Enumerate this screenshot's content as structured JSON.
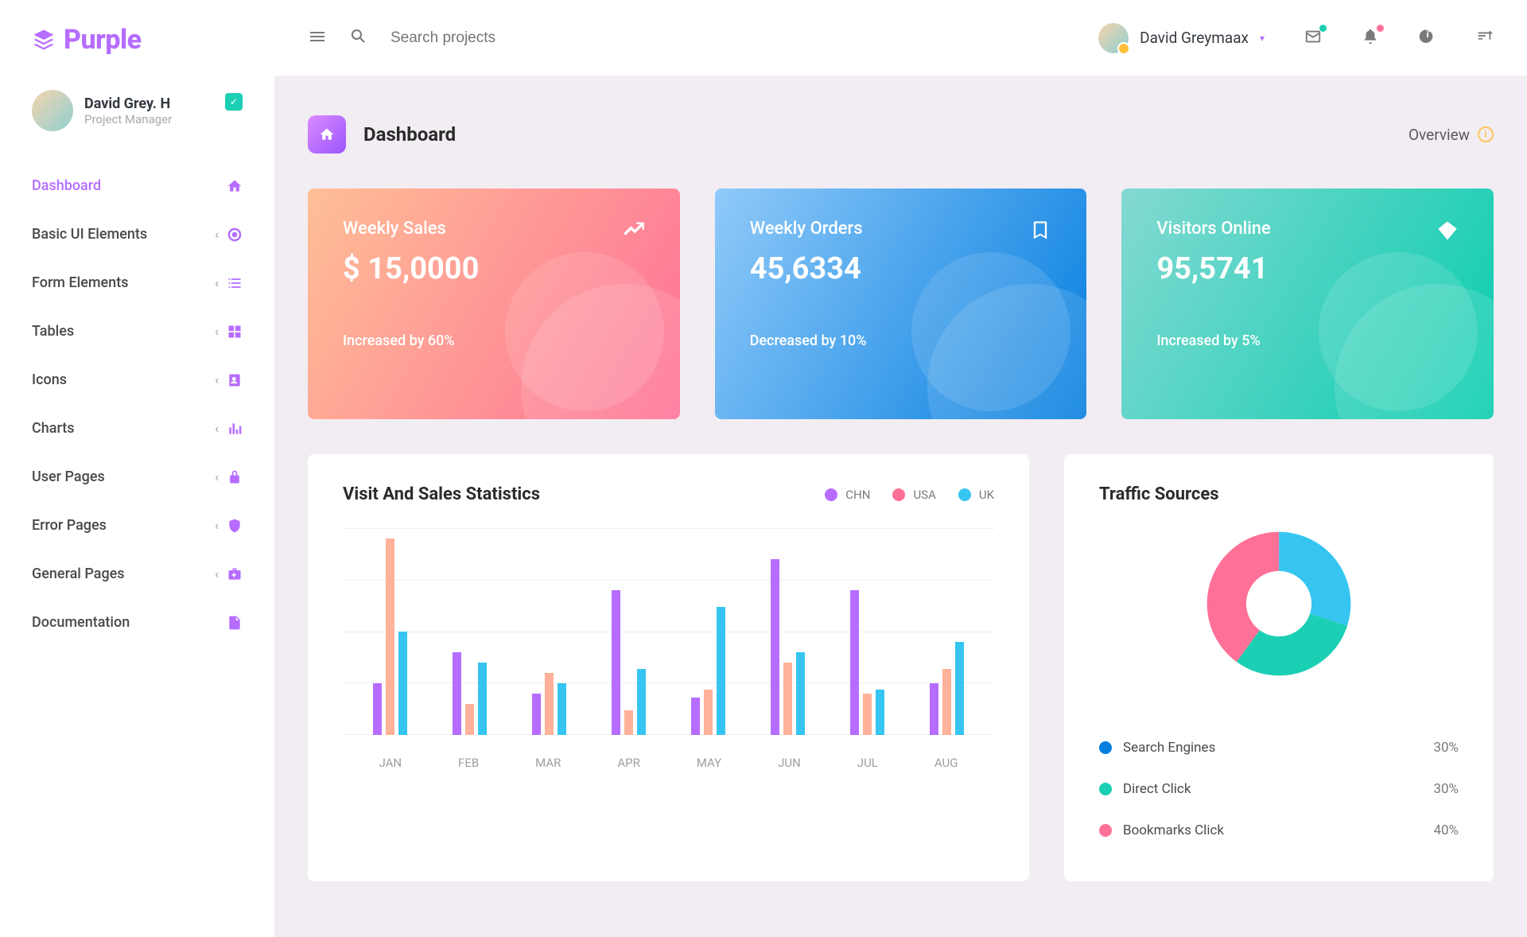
{
  "brand": "Purple",
  "topbar": {
    "search_placeholder": "Search projects",
    "user_name": "David Greymaax"
  },
  "profile": {
    "name": "David Grey. H",
    "role": "Project Manager"
  },
  "nav": [
    {
      "label": "Dashboard",
      "icon": "home",
      "active": true,
      "expandable": false
    },
    {
      "label": "Basic UI Elements",
      "icon": "target",
      "expandable": true
    },
    {
      "label": "Form Elements",
      "icon": "list",
      "expandable": true
    },
    {
      "label": "Tables",
      "icon": "grid",
      "expandable": true
    },
    {
      "label": "Icons",
      "icon": "contacts",
      "expandable": true
    },
    {
      "label": "Charts",
      "icon": "chart",
      "expandable": true
    },
    {
      "label": "User Pages",
      "icon": "lock",
      "expandable": true
    },
    {
      "label": "Error Pages",
      "icon": "shield",
      "expandable": true
    },
    {
      "label": "General Pages",
      "icon": "medkit",
      "expandable": true
    },
    {
      "label": "Documentation",
      "icon": "doc",
      "expandable": false
    }
  ],
  "page": {
    "title": "Dashboard",
    "overview_label": "Overview"
  },
  "stats": [
    {
      "title": "Weekly Sales",
      "value": "$ 15,0000",
      "sub": "Increased by 60%",
      "variant": "red",
      "icon": "chart-line"
    },
    {
      "title": "Weekly Orders",
      "value": "45,6334",
      "sub": "Decreased by 10%",
      "variant": "blue",
      "icon": "bookmark"
    },
    {
      "title": "Visitors Online",
      "value": "95,5741",
      "sub": "Increased by 5%",
      "variant": "green",
      "icon": "diamond"
    }
  ],
  "bar_chart": {
    "title": "Visit And Sales Statistics",
    "legend": [
      {
        "label": "CHN",
        "color": "#b66dff"
      },
      {
        "label": "USA",
        "color": "#fe7096"
      },
      {
        "label": "UK",
        "color": "#36c5f0"
      }
    ]
  },
  "traffic": {
    "title": "Traffic Sources",
    "items": [
      {
        "label": "Search Engines",
        "pct": "30%",
        "color": "#047edf"
      },
      {
        "label": "Direct Click",
        "pct": "30%",
        "color": "#1bcfb4"
      },
      {
        "label": "Bookmarks Click",
        "pct": "40%",
        "color": "#fe7096"
      }
    ]
  },
  "chart_data": [
    {
      "type": "bar",
      "title": "Visit And Sales Statistics",
      "categories": [
        "JAN",
        "FEB",
        "MAR",
        "APR",
        "MAY",
        "JUN",
        "JUL",
        "AUG"
      ],
      "series": [
        {
          "name": "CHN",
          "values": [
            25,
            40,
            20,
            70,
            18,
            85,
            70,
            25
          ]
        },
        {
          "name": "USA",
          "values": [
            95,
            15,
            30,
            12,
            22,
            35,
            20,
            32
          ]
        },
        {
          "name": "UK",
          "values": [
            50,
            35,
            25,
            32,
            62,
            40,
            22,
            45
          ]
        }
      ],
      "ylim": [
        0,
        100
      ],
      "xlabel": "",
      "ylabel": ""
    },
    {
      "type": "pie",
      "title": "Traffic Sources",
      "categories": [
        "Search Engines",
        "Direct Click",
        "Bookmarks Click"
      ],
      "values": [
        30,
        30,
        40
      ],
      "colors": [
        "#36c5f0",
        "#1bcfb4",
        "#fe7096"
      ]
    }
  ]
}
